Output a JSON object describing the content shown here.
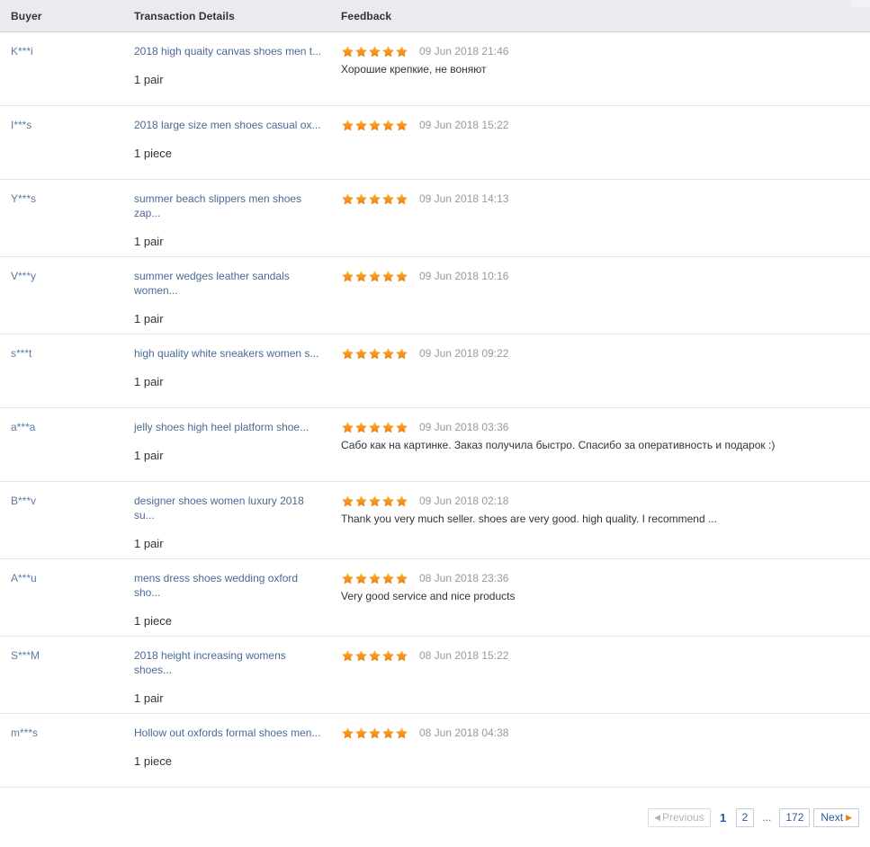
{
  "table": {
    "columns": [
      {
        "key": "buyer",
        "label": "Buyer"
      },
      {
        "key": "details",
        "label": "Transaction Details"
      },
      {
        "key": "feedback",
        "label": "Feedback"
      }
    ],
    "rows": [
      {
        "buyer": "K***i",
        "product": "2018 high quaity canvas shoes men t...",
        "quantity": "1 pair",
        "rating": 5,
        "date": "09 Jun 2018 21:46",
        "comment": "Хорошие крепкие, не воняют"
      },
      {
        "buyer": "I***s",
        "product": "2018 large size men shoes casual ox...",
        "quantity": "1 piece",
        "rating": 5,
        "date": "09 Jun 2018 15:22",
        "comment": ""
      },
      {
        "buyer": "Y***s",
        "product": "summer beach slippers men shoes zap...",
        "quantity": "1 pair",
        "rating": 5,
        "date": "09 Jun 2018 14:13",
        "comment": ""
      },
      {
        "buyer": "V***y",
        "product": "summer wedges leather sandals women...",
        "quantity": "1 pair",
        "rating": 5,
        "date": "09 Jun 2018 10:16",
        "comment": ""
      },
      {
        "buyer": "s***t",
        "product": "high quality white sneakers women s...",
        "quantity": "1 pair",
        "rating": 5,
        "date": "09 Jun 2018 09:22",
        "comment": ""
      },
      {
        "buyer": "a***a",
        "product": "jelly shoes high heel platform shoe...",
        "quantity": "1 pair",
        "rating": 5,
        "date": "09 Jun 2018 03:36",
        "comment": "Сабо как на картинке. Заказ получила быстро. Спасибо за оперативность и подарок :)"
      },
      {
        "buyer": "B***v",
        "product": "designer shoes women luxury 2018 su...",
        "quantity": "1 pair",
        "rating": 5,
        "date": "09 Jun 2018 02:18",
        "comment": "Thank you very much seller. shoes are very good. high quality. I recommend ..."
      },
      {
        "buyer": "A***u",
        "product": "mens dress shoes wedding oxford sho...",
        "quantity": "1 piece",
        "rating": 5,
        "date": "08 Jun 2018 23:36",
        "comment": "Very good service and nice products"
      },
      {
        "buyer": "S***M",
        "product": "2018 height increasing womens shoes...",
        "quantity": "1 pair",
        "rating": 5,
        "date": "08 Jun 2018 15:22",
        "comment": ""
      },
      {
        "buyer": "m***s",
        "product": "Hollow out oxfords formal shoes men...",
        "quantity": "1 piece",
        "rating": 5,
        "date": "08 Jun 2018 04:38",
        "comment": ""
      }
    ]
  },
  "pagination": {
    "previous_label": "Previous",
    "next_label": "Next",
    "ellipsis": "...",
    "pages": [
      "1",
      "2",
      "172"
    ],
    "current_page": "1"
  },
  "colors": {
    "star": "#f7941e",
    "link": "#4a6a96",
    "header_bg": "#e9ebf1",
    "date": "#999999",
    "page_link": "#2a5a9e"
  }
}
